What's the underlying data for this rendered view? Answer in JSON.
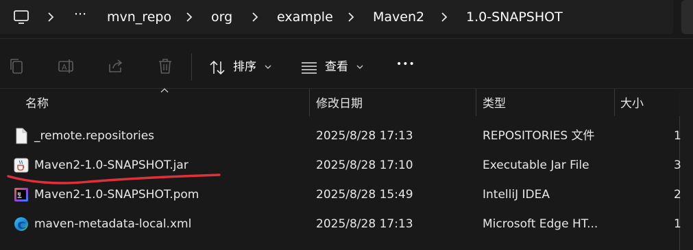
{
  "breadcrumb": {
    "items": [
      "mvn_repo",
      "org",
      "example",
      "Maven2",
      "1.0-SNAPSHOT"
    ],
    "ellipsis": "···"
  },
  "toolbar": {
    "sort_label": "排序",
    "view_label": "查看",
    "more_label": "•••"
  },
  "columns": {
    "name": "名称",
    "modified": "修改日期",
    "type": "类型",
    "size": "大小"
  },
  "files": [
    {
      "name": "_remote.repositories",
      "modified": "2025/8/28 17:13",
      "type": "REPOSITORIES 文件",
      "size": "1",
      "icon": "blank-file-icon"
    },
    {
      "name": "Maven2-1.0-SNAPSHOT.jar",
      "modified": "2025/8/28 17:10",
      "type": "Executable Jar File",
      "size": "3",
      "icon": "java-jar-icon"
    },
    {
      "name": "Maven2-1.0-SNAPSHOT.pom",
      "modified": "2025/8/28 15:49",
      "type": "IntelliJ IDEA",
      "size": "2",
      "icon": "intellij-icon"
    },
    {
      "name": "maven-metadata-local.xml",
      "modified": "2025/8/28 17:13",
      "type": "Microsoft Edge HT...",
      "size": "1",
      "icon": "edge-icon"
    }
  ],
  "colors": {
    "background": "#191919",
    "annotation_underline": "#e0303a"
  }
}
